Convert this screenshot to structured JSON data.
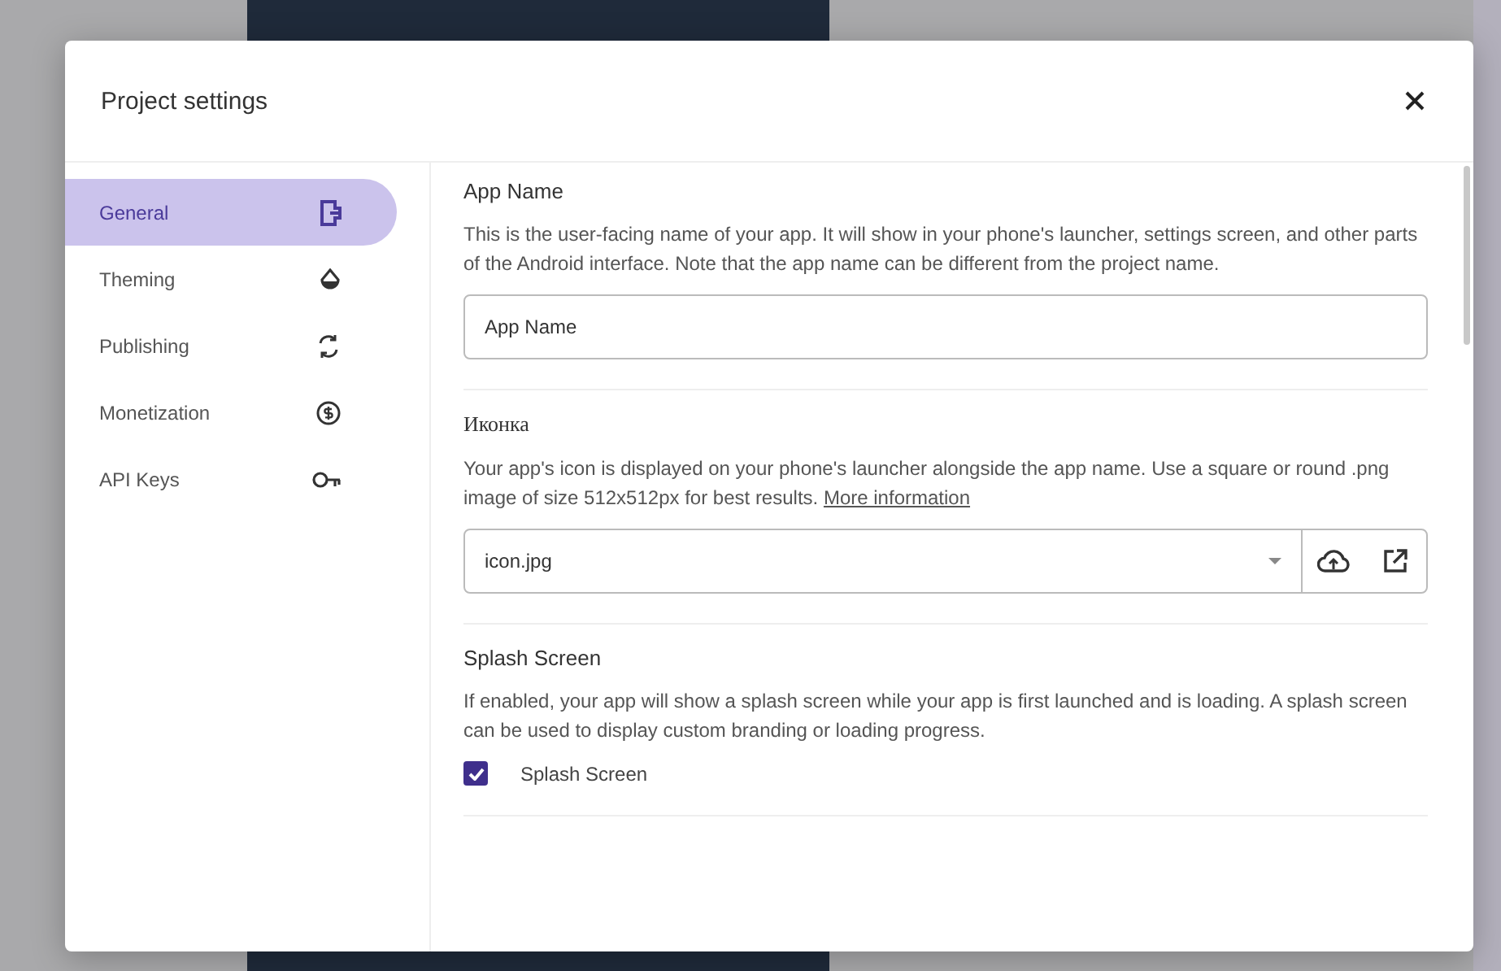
{
  "dialog": {
    "title": "Project settings"
  },
  "sidebar": {
    "items": [
      {
        "label": "General",
        "selected": true
      },
      {
        "label": "Theming",
        "selected": false
      },
      {
        "label": "Publishing",
        "selected": false
      },
      {
        "label": "Monetization",
        "selected": false
      },
      {
        "label": "API Keys",
        "selected": false
      }
    ]
  },
  "sections": [
    {
      "kind": "text",
      "title": "App Name",
      "description": "This is the user-facing name of your app. It will show in your phone's launcher, settings screen, and other parts of the Android interface. Note that the app name can be different from the project name.",
      "value": "App Name"
    },
    {
      "kind": "file",
      "title": "Иконка",
      "description": "Your app's icon is displayed on your phone's launcher alongside the app name. Use a square or round .png image of size 512x512px for best results.",
      "link": "More information",
      "value": "icon.jpg"
    },
    {
      "kind": "checkbox",
      "title": "Splash Screen",
      "description": "If enabled, your app will show a splash screen while your app is first launched and is loading. A splash screen can be used to display custom branding or loading progress.",
      "checkbox": {
        "label": "Splash Screen",
        "checked": true
      }
    }
  ]
}
